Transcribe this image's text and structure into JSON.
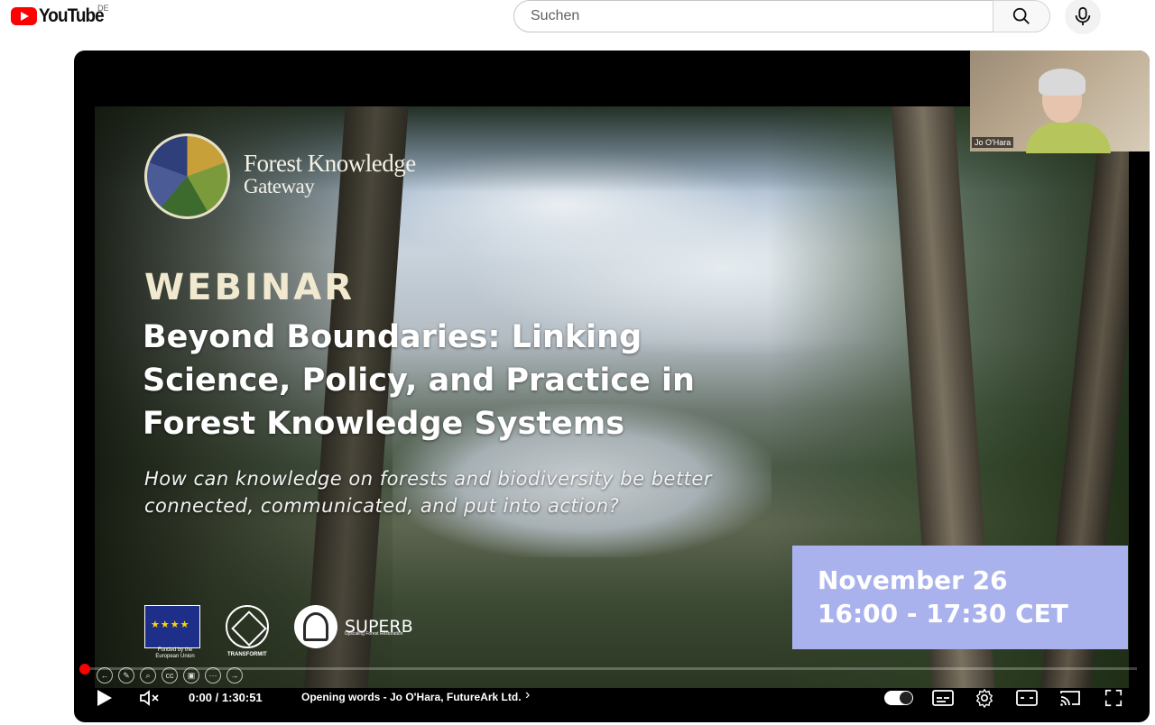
{
  "header": {
    "logo_text": "YouTube",
    "country_code": "DE",
    "search_placeholder": "Suchen"
  },
  "slide": {
    "logo_line1": "Forest Knowledge",
    "logo_line2": "Gateway",
    "eyebrow": "WEBINAR",
    "headline": "Beyond Boundaries: Linking Science, Policy, and Practice in Forest Knowledge Systems",
    "question": "How can knowledge on forests and biodiversity be better connected, communicated, and put into action?",
    "date": "November 26",
    "time": "16:00 - 17:30 CET",
    "partner_eu_caption": "Funded by the European Union",
    "partner_transformit": "TRANSFORMIT",
    "partner_superb": "SUPERB",
    "partner_superb_sub": "Upscaling Forest Restoration"
  },
  "camera": {
    "speaker_name": "Jo O'Hara"
  },
  "controls": {
    "time_display": "0:00 / 1:30:51",
    "chapter_title": "Opening words - Jo O'Hara, FutureArk Ltd.",
    "progress_fraction": 0.0
  },
  "icons": [
    "youtube-logo",
    "search-icon",
    "microphone-icon",
    "play-icon",
    "mute-icon",
    "chevron-right-icon",
    "autoplay-toggle",
    "subtitles-icon",
    "settings-icon",
    "theater-mode-icon",
    "cast-icon",
    "fullscreen-icon"
  ]
}
